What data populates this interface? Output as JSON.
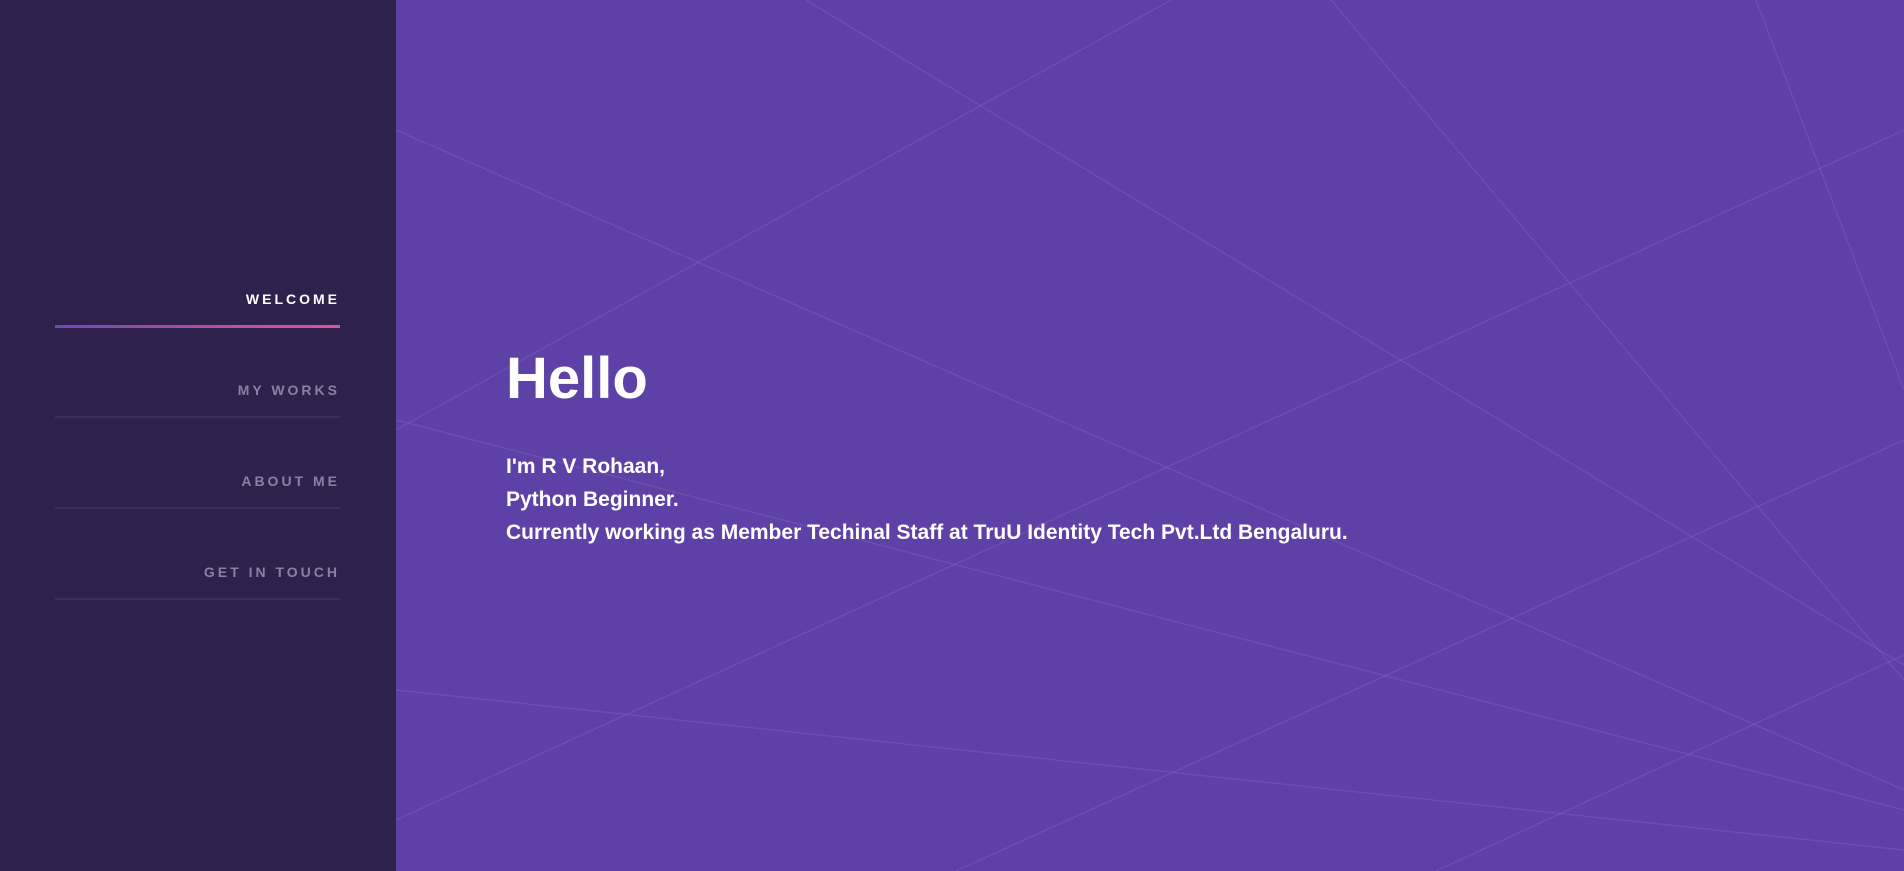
{
  "sidebar": {
    "nav": [
      {
        "label": "WELCOME",
        "active": true
      },
      {
        "label": "MY WORKS",
        "active": false
      },
      {
        "label": "ABOUT ME",
        "active": false
      },
      {
        "label": "GET IN TOUCH",
        "active": false
      }
    ]
  },
  "main": {
    "title": "Hello",
    "intro_lines": [
      "I'm R V Rohaan,",
      "Python Beginner.",
      "Currently working as Member Techinal Staff at TruU Identity Tech Pvt.Ltd Bengaluru."
    ]
  },
  "colors": {
    "sidebar_bg": "#2e224d",
    "main_bg": "#5e41a6",
    "accent_gradient_start": "#6e49b8",
    "accent_gradient_end": "#e2519d",
    "nav_inactive_text": "#8c7fa3",
    "nav_active_text": "#ffffff"
  }
}
